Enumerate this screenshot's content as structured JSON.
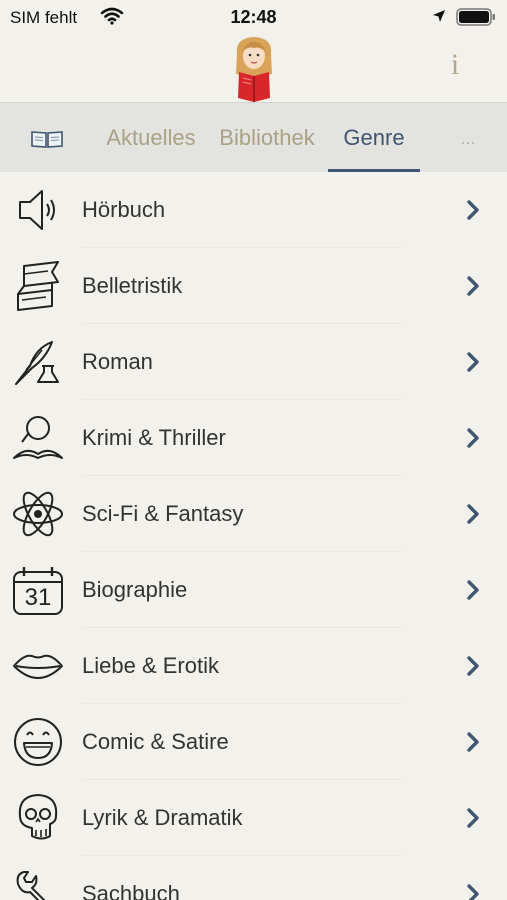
{
  "status": {
    "carrier": "SIM fehlt",
    "time": "12:48"
  },
  "header": {
    "info_label": "i"
  },
  "tabs": [
    {
      "label": "Aktuelles"
    },
    {
      "label": "Bibliothek"
    },
    {
      "label": "Genre"
    },
    {
      "label": "..."
    }
  ],
  "genres": [
    {
      "label": "Hörbuch",
      "icon": "speaker-icon"
    },
    {
      "label": "Belletristik",
      "icon": "ribbon-banner-icon"
    },
    {
      "label": "Roman",
      "icon": "quill-inkwell-icon"
    },
    {
      "label": "Krimi & Thriller",
      "icon": "monocle-mustache-icon"
    },
    {
      "label": "Sci-Fi & Fantasy",
      "icon": "atom-icon"
    },
    {
      "label": "Biographie",
      "icon": "calendar-icon",
      "icon_text": "31"
    },
    {
      "label": "Liebe & Erotik",
      "icon": "lips-icon"
    },
    {
      "label": "Comic & Satire",
      "icon": "laughing-face-icon"
    },
    {
      "label": "Lyrik & Dramatik",
      "icon": "skull-icon"
    },
    {
      "label": "Sachbuch",
      "icon": "wrench-icon"
    }
  ],
  "colors": {
    "background": "#f3f1ec",
    "tab_bar": "#e3e3df",
    "tab_active": "#3f5672",
    "tab_inactive": "#a9a287",
    "chevron": "#3f5672",
    "info": "#b3a88a"
  }
}
